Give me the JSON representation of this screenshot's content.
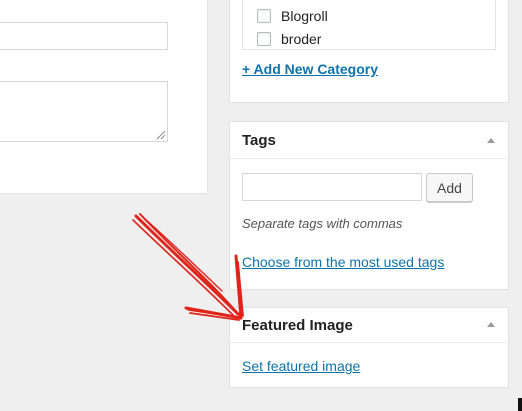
{
  "categories": {
    "items": [
      "Blogroll",
      "broder"
    ],
    "add_new_label": "+ Add New Category"
  },
  "tags": {
    "title": "Tags",
    "input_value": "",
    "add_button_label": "Add",
    "hint": "Separate tags with commas",
    "most_used_link": "Choose from the most used tags"
  },
  "featured_image": {
    "title": "Featured Image",
    "set_link": "Set featured image"
  },
  "colors": {
    "link": "#0e73aa",
    "annotation_arrow": "#e0241b"
  },
  "icons": [
    "resize-grip-icon",
    "collapse-arrow-icon",
    "annotation-arrow"
  ]
}
